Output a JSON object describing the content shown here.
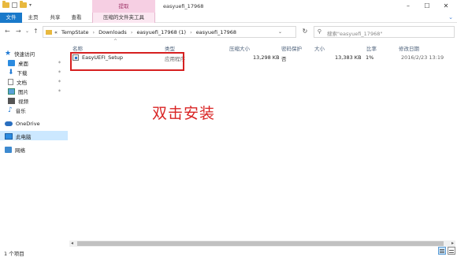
{
  "window": {
    "title": "easyuefi_17968",
    "context_tab": "提取",
    "controls": {
      "minimize": "–",
      "maximize": "☐",
      "close": "✕"
    }
  },
  "ribbon": {
    "tabs": [
      "文件",
      "主页",
      "共享",
      "查看",
      "压缩的文件夹工具"
    ],
    "expand": "⌄"
  },
  "address": {
    "overflow": "«",
    "crumbs": [
      "TempState",
      "Downloads",
      "easyuefi_17968 (1)",
      "easyuefi_17968"
    ],
    "dropdown": "⌄",
    "refresh": "↻"
  },
  "search": {
    "placeholder": "搜索\"easyuefi_17968\""
  },
  "nav": {
    "back": "←",
    "forward": "→",
    "recent": "⌄",
    "up": "↑"
  },
  "sidebar": {
    "items": [
      {
        "label": "快速访问",
        "icon": "star-icon",
        "pinned": false
      },
      {
        "label": "桌面",
        "icon": "desktop-icon",
        "pinned": true
      },
      {
        "label": "下载",
        "icon": "download-icon",
        "pinned": true
      },
      {
        "label": "文档",
        "icon": "document-icon",
        "pinned": true
      },
      {
        "label": "图片",
        "icon": "pictures-icon",
        "pinned": true
      },
      {
        "label": "视频",
        "icon": "video-icon",
        "pinned": false
      },
      {
        "label": "音乐",
        "icon": "music-icon",
        "pinned": false
      },
      {
        "label": "OneDrive",
        "icon": "onedrive-icon",
        "pinned": false
      },
      {
        "label": "此电脑",
        "icon": "this-pc-icon",
        "pinned": false
      },
      {
        "label": "网络",
        "icon": "network-icon",
        "pinned": false
      }
    ],
    "pin_glyph": "✶"
  },
  "columns": {
    "name": "名称",
    "type": "类型",
    "compressed_size": "压缩大小",
    "password": "密码保护",
    "size": "大小",
    "ratio": "比率",
    "modified": "修改日期",
    "sort_glyph": "^"
  },
  "files": [
    {
      "name": "EasyUEFI_Setup",
      "type": "应用程序",
      "compressed_size": "13,298 KB",
      "password": "否",
      "size": "13,383 KB",
      "ratio": "1%",
      "modified": "2016/2/23 13:19"
    }
  ],
  "annotation": "双击安装",
  "status": {
    "item_count": "1 个项目"
  },
  "colors": {
    "annotation": "#d92424",
    "file_tab": "#1979ca",
    "context_tab": "#f6cfe3"
  }
}
